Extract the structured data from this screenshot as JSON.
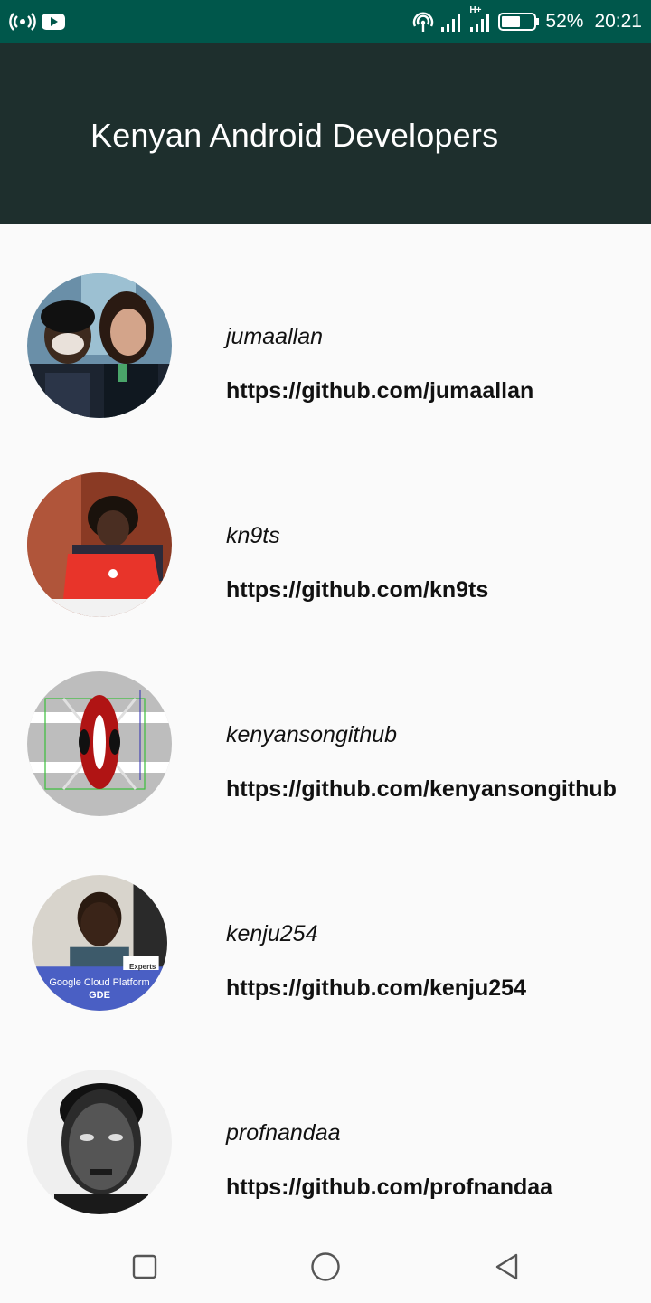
{
  "status_bar": {
    "battery_percent": "52%",
    "time": "20:21",
    "network_label": "H+"
  },
  "app_bar": {
    "title": "Kenyan Android Developers"
  },
  "developers": [
    {
      "username": "jumaallan",
      "url": "https://github.com/jumaallan"
    },
    {
      "username": "kn9ts",
      "url": "https://github.com/kn9ts"
    },
    {
      "username": "kenyansongithub",
      "url": "https://github.com/kenyansongithub"
    },
    {
      "username": "kenju254",
      "url": "https://github.com/kenju254",
      "avatar_caption_1": "Google Cloud Platform",
      "avatar_caption_2": "GDE",
      "avatar_badge": "Experts"
    },
    {
      "username": "profnandaa",
      "url": "https://github.com/profnandaa"
    }
  ],
  "nav_bar": {
    "recents_icon": "square-icon",
    "home_icon": "circle-icon",
    "back_icon": "triangle-back-icon"
  },
  "colors": {
    "status_bar": "#00574b",
    "app_bar": "#1e2f2d",
    "background": "#fafafa"
  }
}
